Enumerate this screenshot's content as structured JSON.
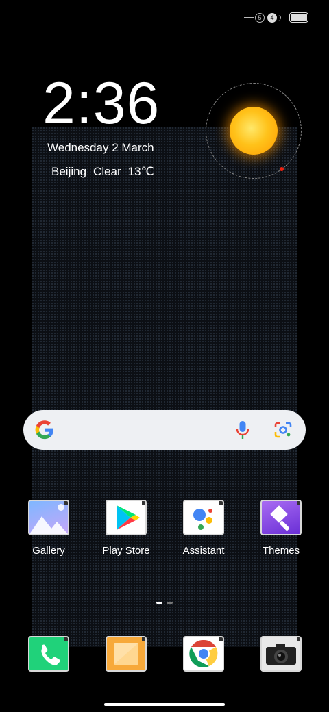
{
  "status_bar": {
    "sim1": "5",
    "sim2": "4"
  },
  "lock": {
    "time": "2:36",
    "date": "Wednesday 2 March",
    "city": "Beijing",
    "condition": "Clear",
    "temperature": "13℃"
  },
  "search": {
    "logo": "google-g-icon",
    "mic": "microphone-icon",
    "lens": "google-lens-icon"
  },
  "apps": [
    {
      "label": "Gallery",
      "icon": "gallery-icon"
    },
    {
      "label": "Play Store",
      "icon": "play-store-icon"
    },
    {
      "label": "Assistant",
      "icon": "assistant-icon"
    },
    {
      "label": "Themes",
      "icon": "themes-icon"
    }
  ],
  "dock": [
    {
      "icon": "phone-icon"
    },
    {
      "icon": "notes-icon"
    },
    {
      "icon": "chrome-icon"
    },
    {
      "icon": "camera-icon"
    }
  ],
  "colors": {
    "background": "#000000",
    "search_bar": "#eef0f3",
    "sun": "#ffb000"
  }
}
